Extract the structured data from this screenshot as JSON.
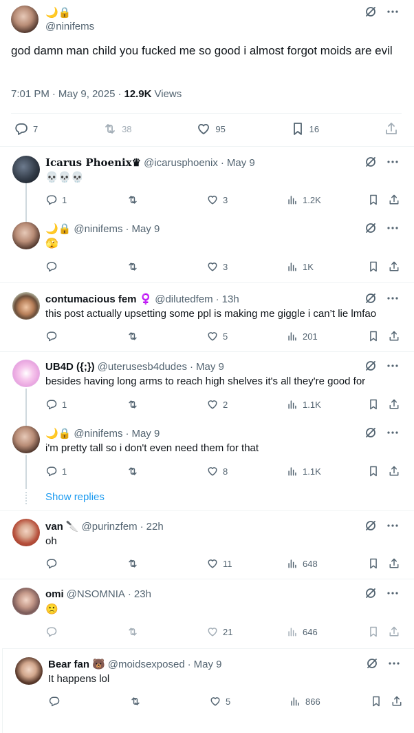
{
  "main_post": {
    "display_name_emoji": "🌙🔒",
    "handle": "@ninifems",
    "text": "god damn man child you fucked me so good i almost forgot moids are evil",
    "time": "7:01 PM",
    "date": "May 9, 2025",
    "views_count": "12.9K",
    "views_label": "Views",
    "replies": "7",
    "reposts": "38",
    "likes": "95",
    "bookmarks": "16"
  },
  "replies": [
    {
      "name": "𝐈𝐜𝐚𝐫𝐮𝐬 𝐏𝐡𝐨𝐞𝐧𝐢𝐱♛",
      "handle": "@icarusphoenix",
      "dot": "·",
      "date": "May 9",
      "text": "💀💀💀",
      "replies": "1",
      "reposts": "",
      "likes": "3",
      "views": "1.2K"
    },
    {
      "name": "🌙🔒",
      "handle": "@ninifems",
      "dot": "·",
      "date": "May 9",
      "text": "🫣",
      "replies": "",
      "reposts": "",
      "likes": "3",
      "views": "1K"
    },
    {
      "name": "contumacious fem",
      "badge": "♀️",
      "handle": "@dilutedfem",
      "dot": "·",
      "date": "13h",
      "text": "this post actually upsetting some ppl is making me giggle i can’t lie lmfao",
      "replies": "",
      "reposts": "",
      "likes": "5",
      "views": "201"
    },
    {
      "name": "UB4D ({;})",
      "handle": "@uterusesb4dudes",
      "dot": "·",
      "date": "May 9",
      "text": "besides having long arms to reach high shelves it's all they're good for",
      "replies": "1",
      "reposts": "",
      "likes": "2",
      "views": "1.1K"
    },
    {
      "name": "🌙🔒",
      "handle": "@ninifems",
      "dot": "·",
      "date": "May 9",
      "text": "i'm pretty tall so i don't even need them for that",
      "replies": "1",
      "reposts": "",
      "likes": "8",
      "views": "1.1K"
    },
    {
      "name": "van",
      "badge": "🔪",
      "handle": "@purinzfem",
      "dot": "·",
      "date": "22h",
      "text": "oh",
      "replies": "",
      "reposts": "",
      "likes": "11",
      "views": "648"
    },
    {
      "name": "omi",
      "handle": "@NSOMNIA",
      "dot": "·",
      "date": "23h",
      "text": "🙁",
      "replies": "",
      "reposts": "",
      "likes": "21",
      "views": "646"
    },
    {
      "name": "Bear fan",
      "badge": "🐻",
      "handle": "@moidsexposed",
      "dot": "·",
      "date": "May 9",
      "text": "It happens lol",
      "replies": "",
      "reposts": "",
      "likes": "5",
      "views": "866"
    }
  ],
  "show_replies_label": "Show replies",
  "icons": {
    "grok": "grok-slash-icon",
    "more": "more-dots-icon",
    "reply": "reply-bubble-icon",
    "repost": "repost-icon",
    "like": "heart-icon",
    "views": "views-bars-icon",
    "bookmark": "bookmark-icon",
    "share": "share-icon"
  },
  "colors": {
    "link": "#1d9bf0",
    "secondary_text": "#536471",
    "divider": "#eff3f4"
  }
}
